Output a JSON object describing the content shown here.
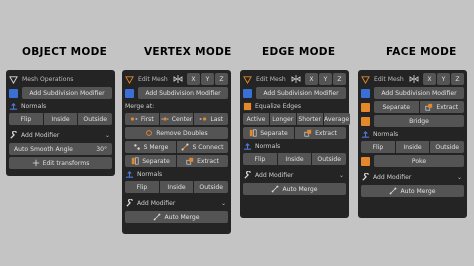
{
  "colors": {
    "background": "#c4c4c4",
    "panel": "#242424",
    "button": "#545454",
    "accent_blue": "#4a7ad8",
    "accent_orange": "#e3882b",
    "checkbox_blue": "#3a6fd8"
  },
  "object_mode": {
    "title": "OBJECT MODE",
    "header": "Mesh Operations",
    "add_subdivision": "Add Subdivision Modifier",
    "normals_label": "Normals",
    "normals": [
      "Flip",
      "Inside",
      "Outside"
    ],
    "add_modifier": "Add Modifier",
    "auto_smooth_label": "Auto Smooth Angle",
    "auto_smooth_value": "30°",
    "edit_transforms": "Edit transforms"
  },
  "vertex_mode": {
    "title": "VERTEX MODE",
    "header": "Edit Mesh",
    "axes": [
      "X",
      "Y",
      "Z"
    ],
    "add_subdivision": "Add Subdivision Modifier",
    "merge_label": "Merge at:",
    "merge_options": [
      "First",
      "Center",
      "Last"
    ],
    "remove_doubles": "Remove Doubles",
    "s_merge": "S Merge",
    "s_connect": "S Connect",
    "separate": "Separate",
    "extract": "Extract",
    "normals_label": "Normals",
    "normals": [
      "Flip",
      "Inside",
      "Outside"
    ],
    "add_modifier": "Add Modifier",
    "auto_merge": "Auto Merge"
  },
  "edge_mode": {
    "title": "EDGE MODE",
    "header": "Edit Mesh",
    "axes": [
      "X",
      "Y",
      "Z"
    ],
    "add_subdivision": "Add Subdivision Modifier",
    "equalize_label": "Equalize Edges",
    "equalize_options": [
      "Active",
      "Longer",
      "Shorter",
      "Average"
    ],
    "separate": "Separate",
    "extract": "Extract",
    "normals_label": "Normals",
    "normals": [
      "Flip",
      "Inside",
      "Outside"
    ],
    "add_modifier": "Add Modifier",
    "auto_merge": "Auto Merge"
  },
  "face_mode": {
    "title": "FACE MODE",
    "header": "Edit Mesh",
    "axes": [
      "X",
      "Y",
      "Z"
    ],
    "add_subdivision": "Add Subdivision Modifier",
    "separate": "Separate",
    "extract": "Extract",
    "bridge": "Bridge",
    "normals_label": "Normals",
    "normals": [
      "Flip",
      "Inside",
      "Outside"
    ],
    "poke": "Poke",
    "add_modifier": "Add Modifier",
    "auto_merge": "Auto Merge"
  }
}
